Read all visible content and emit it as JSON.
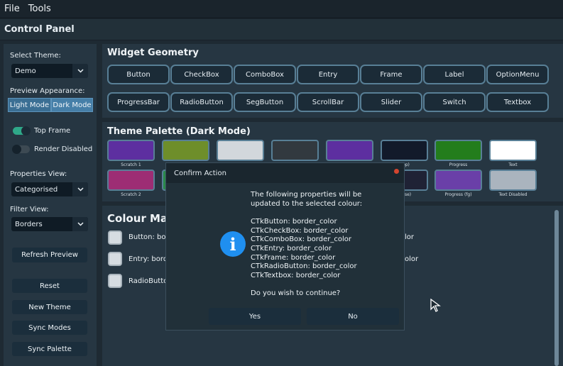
{
  "menu": [
    "File",
    "Tools"
  ],
  "window_title": "Control Panel",
  "sidebar": {
    "select_theme_label": "Select Theme:",
    "theme_value": "Demo",
    "preview_label": "Preview Appearance:",
    "light_mode": "Light Mode",
    "dark_mode": "Dark Mode",
    "top_frame": "Top Frame",
    "top_frame_on": true,
    "render_disabled": "Render Disabled",
    "render_disabled_on": false,
    "properties_view_label": "Properties View:",
    "properties_view_value": "Categorised",
    "filter_view_label": "Filter View:",
    "filter_view_value": "Borders",
    "refresh_preview": "Refresh Preview",
    "reset": "Reset",
    "new_theme": "New Theme",
    "sync_modes": "Sync Modes",
    "sync_palette": "Sync Palette"
  },
  "geometry": {
    "title": "Widget Geometry",
    "row1": [
      "Button",
      "CheckBox",
      "ComboBox",
      "Entry",
      "Frame",
      "Label",
      "OptionMenu"
    ],
    "row2": [
      "ProgressBar",
      "RadioButton",
      "SegButton",
      "ScrollBar",
      "Slider",
      "Switch",
      "Textbox"
    ]
  },
  "palette": {
    "title": "Theme Palette (Dark Mode)",
    "row1": [
      {
        "label": "Scratch 1",
        "color": "#5d2fa0"
      },
      {
        "label": "",
        "color": "#6e8e2a"
      },
      {
        "label": "",
        "color": "#d2d7dc"
      },
      {
        "label": "",
        "color": "#32393f"
      },
      {
        "label": "",
        "color": "#5d2fa0"
      },
      {
        "label": "(Top)",
        "color": "#121a2a"
      },
      {
        "label": "Progress",
        "color": "#237d1c"
      },
      {
        "label": "Text",
        "color": "#ffffff"
      }
    ],
    "row2": [
      {
        "label": "Scratch 2",
        "color": "#9d2d74"
      },
      {
        "label": "",
        "color": "#2a8a4a"
      },
      {
        "label": "(Base)",
        "color": "#1f2235"
      },
      {
        "label": "Progress (fg)",
        "color": "#6a3fa8"
      },
      {
        "label": "Text Disabled",
        "color": "#aab4be"
      }
    ]
  },
  "mapping": {
    "title": "Colour Mapp",
    "items": [
      {
        "label": "Button: bor",
        "right": "lor"
      },
      {
        "label": "Entry: bordo",
        "right": "olor"
      },
      {
        "label": "RadioButto",
        "right": ""
      }
    ]
  },
  "dialog": {
    "title": "Confirm Action",
    "lines": [
      "The following properties will be",
      "updated to the selected colour:",
      "CTkButton: border_color",
      "CTkCheckBox: border_color",
      "CTkComboBox: border_color",
      "CTkEntry: border_color",
      "CTkFrame: border_color",
      "CTkRadioButton: border_color",
      "CTkTextbox: border_color",
      "Do you wish to continue?"
    ],
    "icon": "info-icon",
    "yes": "Yes",
    "no": "No"
  },
  "colors": {
    "accent": "#3b6f94",
    "switch_on": "#2fa889",
    "info": "#1f8ff0"
  }
}
